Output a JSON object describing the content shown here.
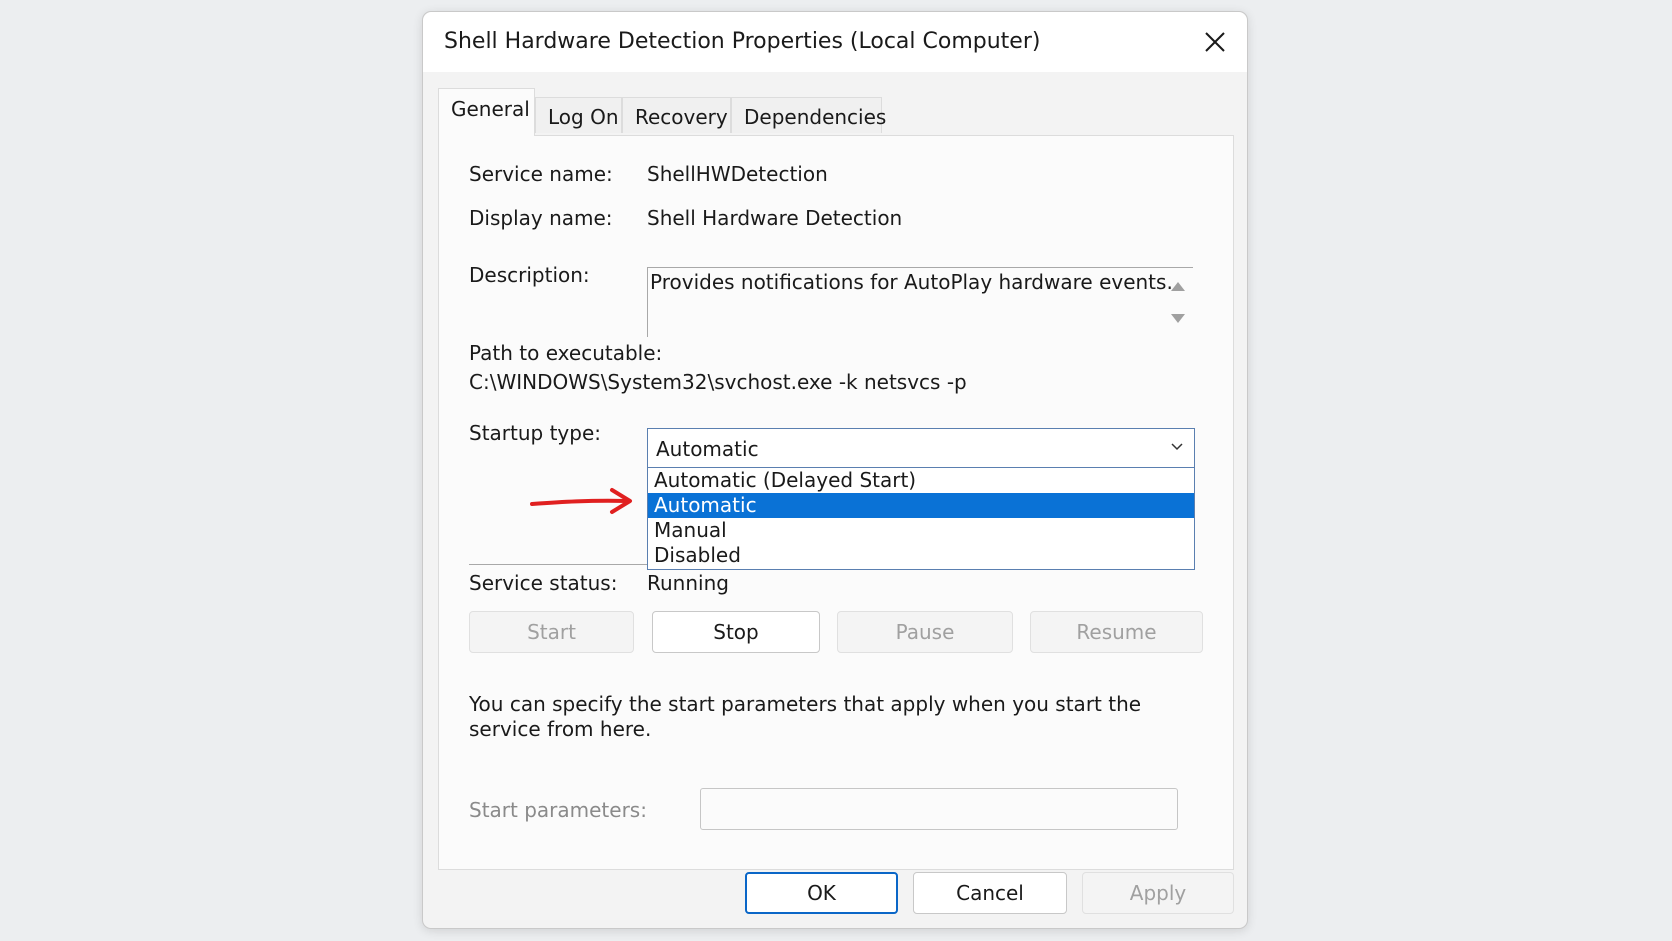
{
  "dialog": {
    "title": "Shell Hardware Detection Properties (Local Computer)",
    "close_icon": "close-icon"
  },
  "tabs": [
    {
      "label": "General",
      "active": true
    },
    {
      "label": "Log On",
      "active": false
    },
    {
      "label": "Recovery",
      "active": false
    },
    {
      "label": "Dependencies",
      "active": false
    }
  ],
  "general": {
    "service_name_label": "Service name:",
    "service_name": "ShellHWDetection",
    "display_name_label": "Display name:",
    "display_name": "Shell Hardware Detection",
    "description_label": "Description:",
    "description": "Provides notifications for AutoPlay hardware events.",
    "path_label": "Path to executable:",
    "path": "C:\\WINDOWS\\System32\\svchost.exe -k netsvcs -p",
    "startup_label": "Startup type:",
    "startup_value": "Automatic",
    "startup_options": [
      {
        "label": "Automatic (Delayed Start)",
        "selected": false
      },
      {
        "label": "Automatic",
        "selected": true
      },
      {
        "label": "Manual",
        "selected": false
      },
      {
        "label": "Disabled",
        "selected": false
      }
    ],
    "status_label": "Service status:",
    "status_value": "Running",
    "buttons": {
      "start": "Start",
      "stop": "Stop",
      "pause": "Pause",
      "resume": "Resume"
    },
    "info_text": "You can specify the start parameters that apply when you start the service from here.",
    "params_label": "Start parameters:",
    "params_value": ""
  },
  "footer": {
    "ok": "OK",
    "cancel": "Cancel",
    "apply": "Apply"
  },
  "colors": {
    "selection": "#0a72d6",
    "annotation_arrow": "#e02020",
    "default_button_border": "#0a66c7"
  }
}
